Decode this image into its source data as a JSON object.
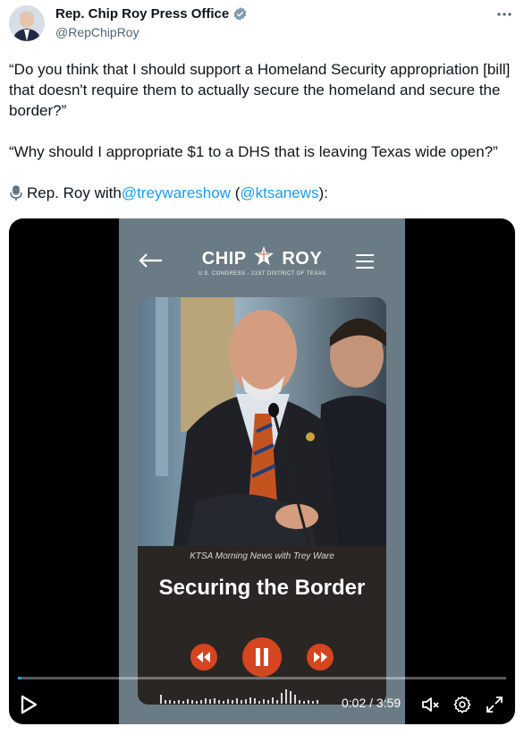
{
  "author": {
    "name": "Rep. Chip Roy Press Office",
    "handle": "@RepChipRoy"
  },
  "menu_icon": "more-horizontal-icon",
  "tweet": {
    "quote1": "“Do you think that I should support a Homeland Security appropriation [bill] that doesn't require them to actually secure the homeland and secure the border?”",
    "quote2": "“Why should I appropriate $1 to a DHS that is leaving Texas wide open?”",
    "credit_prefix": "Rep. Roy with ",
    "mention1": "@treywareshow",
    "paren_open": " (",
    "mention2": "@ktsanews",
    "credit_suffix": "):"
  },
  "video": {
    "brand_left": "CHIP",
    "brand_right": "ROY",
    "brand_sub": "U.S. CONGRESS - 21ST DISTRICT OF TEXAS",
    "caption": "KTSA Morning News with Trey Ware",
    "title": "Securing the Border",
    "current_time": "0:02",
    "separator": " / ",
    "duration": "3:59",
    "progress_fraction": 0.008
  },
  "colors": {
    "link": "#1d9bf0",
    "accent_button": "#d44520",
    "phone_bg": "#6b7b85"
  }
}
